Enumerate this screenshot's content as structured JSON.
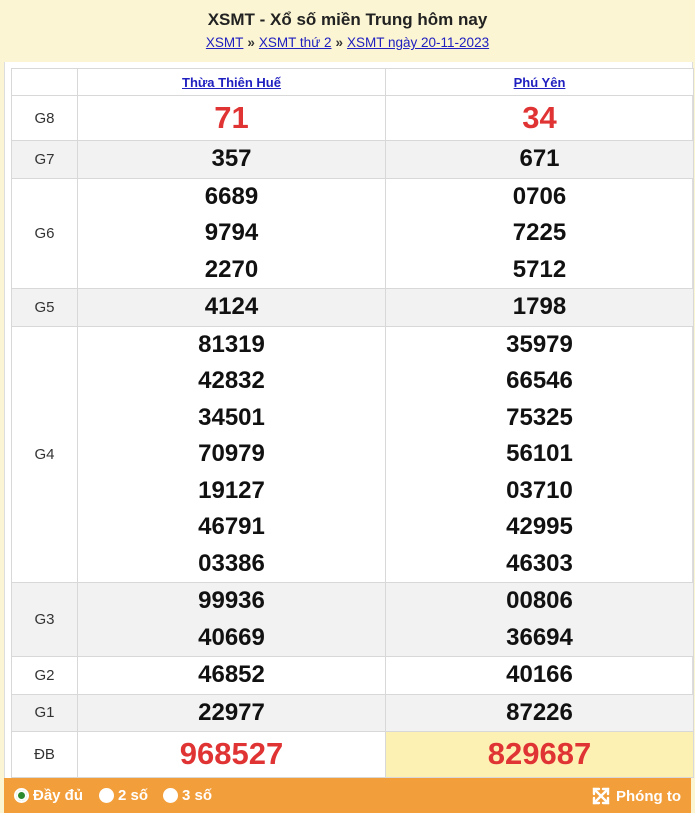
{
  "header": {
    "title": "XSMT - Xổ số miền Trung hôm nay",
    "breadcrumb": [
      "XSMT",
      "XSMT thứ 2",
      "XSMT ngày 20-11-2023"
    ],
    "separator": "»"
  },
  "table": {
    "provinces": [
      "Thừa Thiên Huế",
      "Phú Yên"
    ],
    "rows": [
      {
        "label": "G8",
        "values": [
          [
            "71"
          ],
          [
            "34"
          ]
        ]
      },
      {
        "label": "G7",
        "values": [
          [
            "357"
          ],
          [
            "671"
          ]
        ]
      },
      {
        "label": "G6",
        "values": [
          [
            "6689",
            "9794",
            "2270"
          ],
          [
            "0706",
            "7225",
            "5712"
          ]
        ]
      },
      {
        "label": "G5",
        "values": [
          [
            "4124"
          ],
          [
            "1798"
          ]
        ]
      },
      {
        "label": "G4",
        "values": [
          [
            "81319",
            "42832",
            "34501",
            "70979",
            "19127",
            "46791",
            "03386"
          ],
          [
            "35979",
            "66546",
            "75325",
            "56101",
            "03710",
            "42995",
            "46303"
          ]
        ]
      },
      {
        "label": "G3",
        "values": [
          [
            "99936",
            "40669"
          ],
          [
            "00806",
            "36694"
          ]
        ]
      },
      {
        "label": "G2",
        "values": [
          [
            "46852"
          ],
          [
            "40166"
          ]
        ]
      },
      {
        "label": "G1",
        "values": [
          [
            "22977"
          ],
          [
            "87226"
          ]
        ]
      },
      {
        "label": "ĐB",
        "values": [
          [
            "968527"
          ],
          [
            "829687"
          ]
        ]
      }
    ]
  },
  "footer": {
    "options": [
      "Đầy đủ",
      "2 số",
      "3 số"
    ],
    "selected": "Đầy đủ",
    "zoom_label": "Phóng to"
  },
  "colors": {
    "red": "#e03333",
    "orange": "#f29e3a",
    "link": "#2020c0",
    "highlight": "#fdf0b3"
  }
}
